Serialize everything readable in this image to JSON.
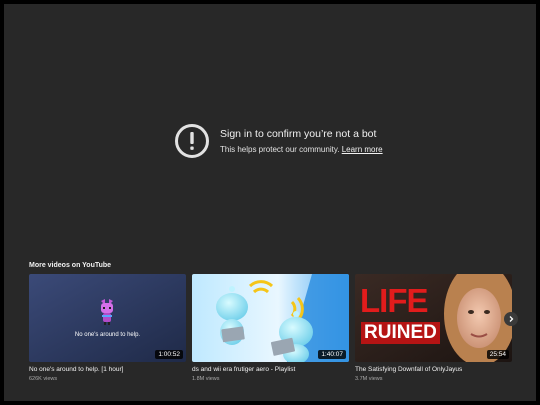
{
  "notice": {
    "title": "Sign in to confirm you’re not a bot",
    "subtitle": "This helps protect our community.",
    "link": "Learn more",
    "icon": "alert-circle-icon"
  },
  "more_videos": {
    "heading": "More videos on YouTube",
    "items": [
      {
        "title": "No one's around to help. [1 hour]",
        "views": "626K views",
        "duration": "1:00:52",
        "thumb_text": "No one's around to help."
      },
      {
        "title": "ds and wii era frutiger aero - Playlist",
        "views": "1.8M views",
        "duration": "1:40:07"
      },
      {
        "title": "The Satisfying Downfall of OnlyJayus",
        "views": "3.7M views",
        "duration": "25:54",
        "thumb_text_1": "LIFE",
        "thumb_text_2": "RUINED"
      }
    ],
    "next_icon": "chevron-right-icon"
  },
  "colors": {
    "player_bg": "#282828",
    "thumb_text_red": "#e21c1c"
  }
}
